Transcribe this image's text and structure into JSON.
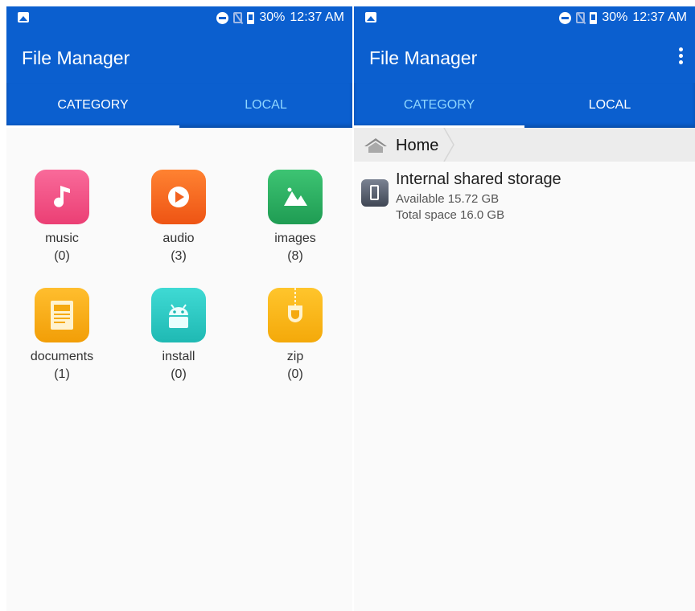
{
  "status_bar": {
    "battery": "30%",
    "time": "12:37 AM"
  },
  "app": {
    "title": "File Manager"
  },
  "tabs": [
    {
      "label": "CATEGORY"
    },
    {
      "label": "LOCAL"
    }
  ],
  "left_screen": {
    "active_tab": "CATEGORY",
    "categories": [
      {
        "name": "music",
        "count": "(0)",
        "icon": "music-note-icon",
        "color": "#f0487b"
      },
      {
        "name": "audio",
        "count": "(3)",
        "icon": "play-icon",
        "color": "#f4661f"
      },
      {
        "name": "images",
        "count": "(8)",
        "icon": "mountain-image-icon",
        "color": "#27ae5e"
      },
      {
        "name": "documents",
        "count": "(1)",
        "icon": "document-icon",
        "color": "#f5a90f"
      },
      {
        "name": "install",
        "count": "(0)",
        "icon": "android-icon",
        "color": "#27c8c3"
      },
      {
        "name": "zip",
        "count": "(0)",
        "icon": "zip-icon",
        "color": "#f6b20d"
      }
    ]
  },
  "right_screen": {
    "active_tab": "LOCAL",
    "breadcrumb": "Home",
    "storage": {
      "name": "Internal shared storage",
      "available": "Available 15.72 GB",
      "total": "Total space 16.0 GB"
    }
  },
  "colors": {
    "primary": "#0b5fcf",
    "tab_inactive": "#bfe2ff",
    "tab_active_text": "#7fd0ff"
  }
}
